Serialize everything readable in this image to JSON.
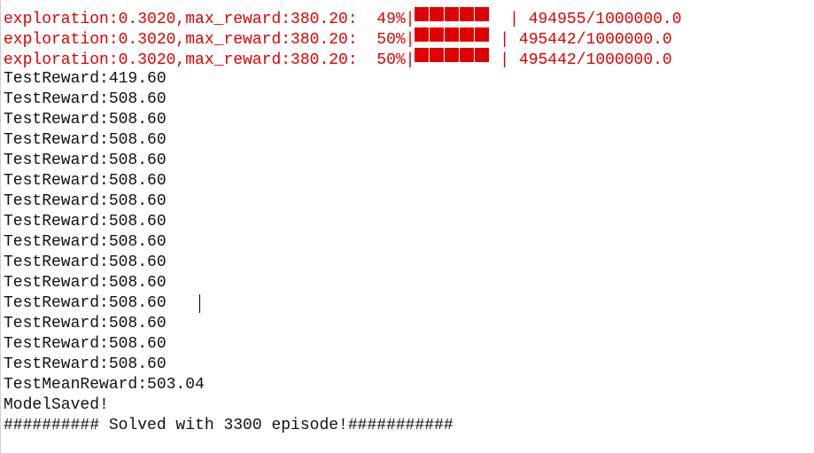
{
  "progress_lines": [
    {
      "prefix": "exploration:0.3020,max_reward:380.20:  49%|",
      "filled_blocks": 5,
      "bar_gap": "  ",
      "suffix": "| 494955/1000000.0"
    },
    {
      "prefix": "exploration:0.3020,max_reward:380.20:  50%|",
      "filled_blocks": 5,
      "bar_gap": " ",
      "suffix": "| 495442/1000000.0"
    },
    {
      "prefix": "exploration:0.3020,max_reward:380.20:  50%|",
      "filled_blocks": 5,
      "bar_gap": " ",
      "suffix": "| 495442/1000000.0"
    }
  ],
  "output_lines": [
    "TestReward:419.60",
    "TestReward:508.60",
    "TestReward:508.60",
    "TestReward:508.60",
    "TestReward:508.60",
    "TestReward:508.60",
    "TestReward:508.60",
    "TestReward:508.60",
    "TestReward:508.60",
    "TestReward:508.60",
    "TestReward:508.60",
    "TestReward:508.60",
    "TestReward:508.60",
    "TestReward:508.60",
    "TestReward:508.60",
    "TestMeanReward:503.04",
    "ModelSaved!",
    "########## Solved with 3300 episode!###########"
  ],
  "colors": {
    "progress_text": "#e00000",
    "output_text": "#111111",
    "background": "#ffffff"
  }
}
